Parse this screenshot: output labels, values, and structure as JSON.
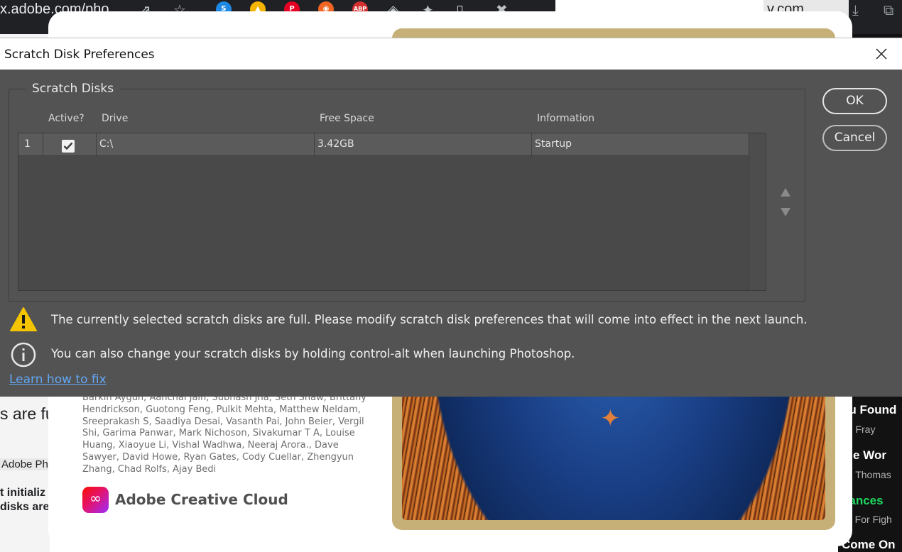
{
  "browser": {
    "url_left": "x.adobe.com/pho",
    "url_right": "v.com",
    "extensions": [
      {
        "icon": "skype-extension-icon",
        "letter": "S",
        "color": "#1e88e5"
      },
      {
        "icon": "google-drive-extension-icon",
        "letter": "▲",
        "color": "#f4b400"
      },
      {
        "icon": "pinterest-extension-icon",
        "letter": "P",
        "color": "#e60023"
      },
      {
        "icon": "rss-extension-icon",
        "letter": "◉",
        "color": "#f26522"
      },
      {
        "icon": "adblock-extension-icon",
        "letter": "ABP",
        "color": "#d32f2f"
      }
    ]
  },
  "background_page": {
    "left_snippets": [
      "s are fu",
      "Adobe Pho",
      "t initializ",
      "disks are"
    ],
    "right_snippets": [
      {
        "text": "ou Found",
        "color": "#ffffff"
      },
      {
        "text": "he Fray",
        "color": "#b3b3b3"
      },
      {
        "text": "ttle Wor",
        "color": "#ffffff"
      },
      {
        "text": "ob Thomas",
        "color": "#b3b3b3"
      },
      {
        "text": "hances",
        "color": "#1ed760"
      },
      {
        "text": "ve For Figh",
        "color": "#b3b3b3"
      },
      {
        "text": "Come On",
        "color": "#ffffff"
      }
    ]
  },
  "splash": {
    "credits": "Barkin Aygun, Aanchal Jain, Subhash Jha, Seth Shaw, Brittany Hendrickson, Guotong Feng, Pulkit Mehta, Matthew Neldam, Sreeprakash S, Saadiya Desai, Vasanth Pai, John Beier, Vergil Shi, Garima Panwar, Mark Nichoson, Sivakumar T A, Louise Huang, Xiaoyue Li, Vishal Wadhwa, Neeraj Arora., Dave Sawyer, David Howe, Ryan Gates, Cody Cuellar, Zhengyun Zhang, Chad Rolfs, Ajay Bedi",
    "brand": "Adobe Creative Cloud"
  },
  "dialog": {
    "title": "Scratch Disk Preferences",
    "group_label": "Scratch Disks",
    "columns": {
      "active": "Active?",
      "drive": "Drive",
      "free_space": "Free Space",
      "information": "Information"
    },
    "rows": [
      {
        "index": "1",
        "active": true,
        "drive": "C:\\",
        "free_space": "3.42GB",
        "information": "Startup"
      }
    ],
    "ok_label": "OK",
    "cancel_label": "Cancel",
    "warning_text": "The currently selected scratch disks are full. Please modify scratch disk preferences that will come into effect in the next launch.",
    "info_text": "You can also change your scratch disks by holding control-alt when launching Photoshop.",
    "learn_link": "Learn how to fix"
  },
  "colors": {
    "dialog_bg": "#535353",
    "warning_yellow": "#f5c400",
    "link_blue": "#62a7f4"
  }
}
